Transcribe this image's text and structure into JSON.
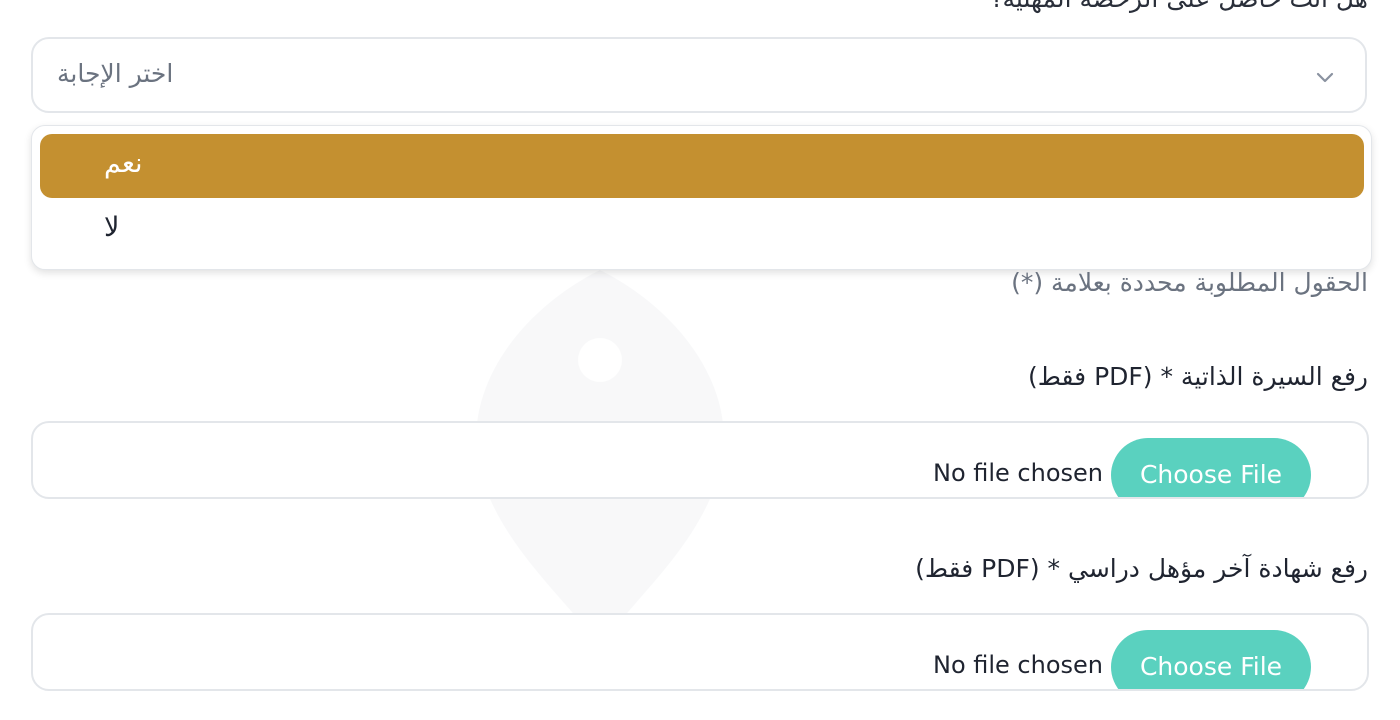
{
  "form": {
    "question_label": "هل أنت حاصل على الرخصة المهنية؟",
    "select_placeholder": "اختر الإجابة",
    "options": [
      "نعم",
      "لا"
    ],
    "highlighted_option": "نعم",
    "required_note": "الحقول المطلوبة محددة بعلامة (*)",
    "cv_upload": {
      "label": "رفع السيرة الذاتية * (PDF فقط)",
      "button": "Choose File",
      "status": "No file chosen"
    },
    "certificate_upload": {
      "label": "رفع شهادة آخر مؤهل دراسي * (PDF فقط)",
      "button": "Choose File",
      "status": "No file chosen"
    }
  },
  "colors": {
    "highlight": "#c49030",
    "button": "#5ad1bf",
    "border": "#e3e6ea",
    "muted_text": "#6b7380"
  },
  "icons": {
    "select_arrow": "chevron-down-icon"
  }
}
